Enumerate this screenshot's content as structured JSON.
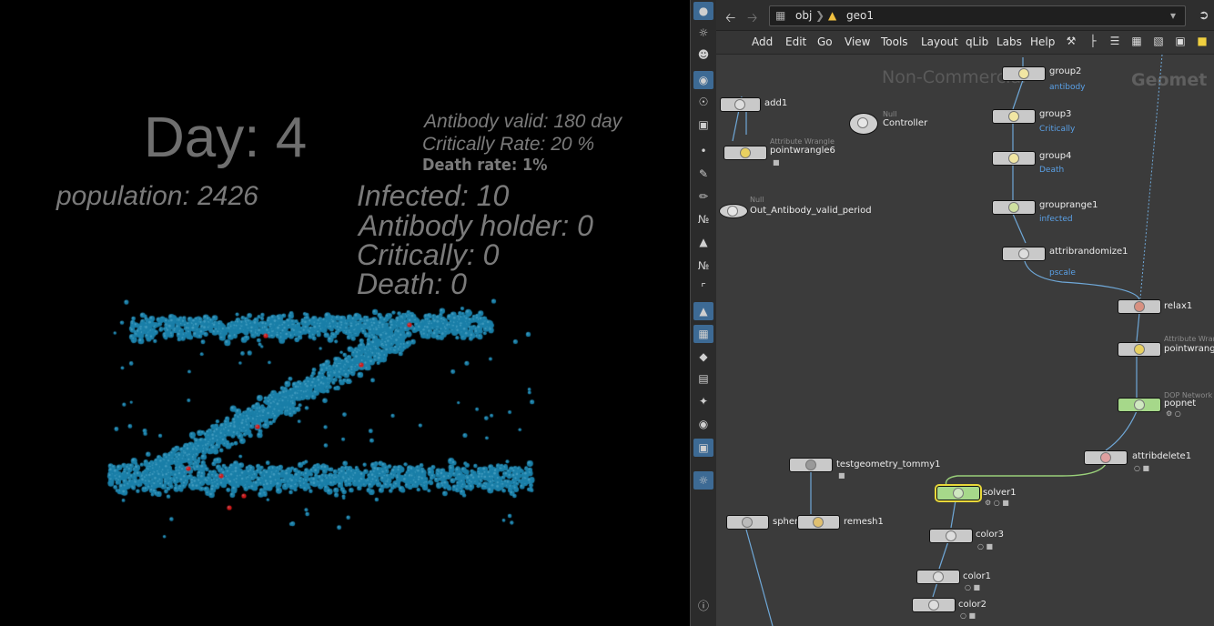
{
  "viewport": {
    "day": "Day: 4",
    "population": "population: 2426",
    "antibody_valid": "Antibody valid: 180 day",
    "critically_rate": "Critically Rate: 20 %",
    "death_rate": "Death rate: 1%",
    "infected": "Infected: 10",
    "antibody_holder": "Antibody holder: 0",
    "critically": "Critically: 0",
    "death": "Death: 0",
    "particle_color": "#1a7fa8",
    "infected_color": "#d21a1a"
  },
  "network": {
    "path": [
      "obj",
      "geo1"
    ],
    "menus": [
      "Add",
      "Edit",
      "Go",
      "View",
      "Tools",
      "Layout",
      "qLib",
      "Labs",
      "Help"
    ],
    "watermark_left": "Non-Commercial",
    "watermark_right": "Geomet",
    "nodes": {
      "add1": "add1",
      "pointwrangle6_type": "Attribute Wrangle",
      "pointwrangle6": "pointwrangle6",
      "null1_type": "Null",
      "out_antibody": "Out_Antibody_valid_period",
      "controller_type": "Null",
      "controller": "Controller",
      "group2": "group2",
      "group2_sub": "antibody",
      "group3": "group3",
      "group3_sub": "Critically",
      "group4": "group4",
      "group4_sub": "Death",
      "grouprange1": "grouprange1",
      "grouprange1_sub": "infected",
      "attribrandomize1": "attribrandomize1",
      "attribrandomize1_sub": "pscale",
      "relax1": "relax1",
      "pointwrangle_type": "Attribute Wrang",
      "pointwrangle": "pointwrangle",
      "popnet_type": "DOP Network",
      "popnet": "popnet",
      "attribdelete1": "attribdelete1",
      "testgeometry": "testgeometry_tommy1",
      "sphere": "sphere",
      "remesh1": "remesh1",
      "solver1": "solver1",
      "color3": "color3",
      "color1": "color1",
      "color2": "color2"
    }
  }
}
